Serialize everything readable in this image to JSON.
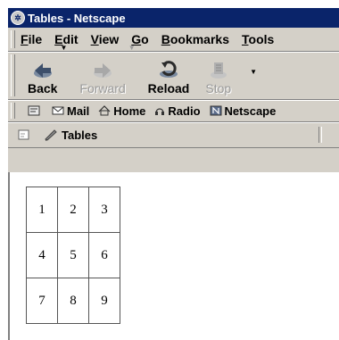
{
  "window": {
    "title": "Tables - Netscape"
  },
  "menubar": {
    "items": [
      {
        "label": "File",
        "key": "F",
        "rest": "ile"
      },
      {
        "label": "Edit",
        "key": "E",
        "rest": "dit"
      },
      {
        "label": "View",
        "key": "V",
        "rest": "iew"
      },
      {
        "label": "Go",
        "key": "G",
        "rest": "o"
      },
      {
        "label": "Bookmarks",
        "key": "B",
        "rest": "ookmarks"
      },
      {
        "label": "Tools",
        "key": "T",
        "rest": "ools"
      }
    ]
  },
  "navbar": {
    "back": "Back",
    "forward": "Forward",
    "reload": "Reload",
    "stop": "Stop"
  },
  "personalbar": {
    "mail": "Mail",
    "home": "Home",
    "radio": "Radio",
    "netscape": "Netscape"
  },
  "tabs": {
    "active_label": "Tables"
  },
  "table": {
    "rows": [
      [
        "1",
        "2",
        "3"
      ],
      [
        "4",
        "5",
        "6"
      ],
      [
        "7",
        "8",
        "9"
      ]
    ]
  },
  "colors": {
    "titlebar": "#0a246a",
    "chrome": "#d4d0c8",
    "content": "#ffffff"
  },
  "icons": [
    "back-icon",
    "forward-icon",
    "reload-icon",
    "stop-icon",
    "mail-icon",
    "home-icon",
    "radio-icon",
    "netscape-icon",
    "tab-icon"
  ]
}
